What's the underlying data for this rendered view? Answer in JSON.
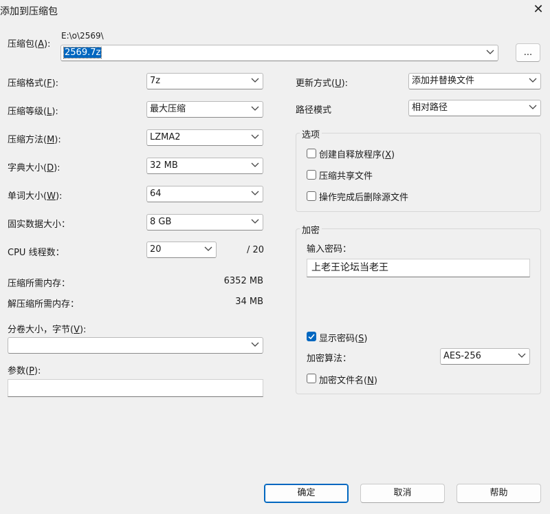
{
  "window": {
    "title": "添加到压缩包",
    "close_glyph": "✕"
  },
  "archive": {
    "label": "压缩包(",
    "label_key": "A",
    "label_tail": "):",
    "path": "E:\\o\\2569\\",
    "filename": "2569.7z",
    "browse_label": "..."
  },
  "left": {
    "format": {
      "label": "压缩格式(",
      "key": "F",
      "tail": "):",
      "value": "7z"
    },
    "level": {
      "label": "压缩等级(",
      "key": "L",
      "tail": "):",
      "value": "最大压缩"
    },
    "method": {
      "label": "压缩方法(",
      "key": "M",
      "tail": "):",
      "value": "LZMA2"
    },
    "dict": {
      "label": "字典大小(",
      "key": "D",
      "tail": "):",
      "value": "32 MB"
    },
    "word": {
      "label": "单词大小(",
      "key": "W",
      "tail": "):",
      "value": "64"
    },
    "solid": {
      "label": "固实数据大小：",
      "value": "8 GB"
    },
    "threads": {
      "label": "CPU 线程数：",
      "value": "20",
      "max": "/ 20"
    },
    "mem_compress": {
      "label": "压缩所需内存：",
      "value": "6352 MB"
    },
    "mem_decompress": {
      "label": "解压缩所需内存：",
      "value": "34 MB"
    },
    "volume": {
      "label": "分卷大小，字节(",
      "key": "V",
      "tail": "):",
      "value": ""
    },
    "params": {
      "label": "参数(",
      "key": "P",
      "tail": "):",
      "value": ""
    }
  },
  "right": {
    "update": {
      "label": "更新方式(",
      "key": "U",
      "tail": "):",
      "value": "添加并替换文件"
    },
    "pathmode": {
      "label": "路径模式",
      "value": "相对路径"
    },
    "options": {
      "title": "选项",
      "sfx": {
        "label": "创建自释放程序(",
        "key": "X",
        "tail": ")",
        "checked": false
      },
      "shared": {
        "label": "压缩共享文件",
        "checked": false
      },
      "delete": {
        "label": "操作完成后删除源文件",
        "checked": false
      }
    },
    "encryption": {
      "title": "加密",
      "password_label": "输入密码：",
      "password_value": "上老王论坛当老王",
      "show": {
        "label": "显示密码(",
        "key": "S",
        "tail": ")",
        "checked": true
      },
      "method_label": "加密算法：",
      "method_value": "AES-256",
      "names": {
        "label": "加密文件名(",
        "key": "N",
        "tail": ")",
        "checked": false
      }
    }
  },
  "buttons": {
    "ok": "确定",
    "cancel": "取消",
    "help": "帮助"
  },
  "colors": {
    "accent": "#0067c0",
    "background": "#f0f0f0"
  }
}
